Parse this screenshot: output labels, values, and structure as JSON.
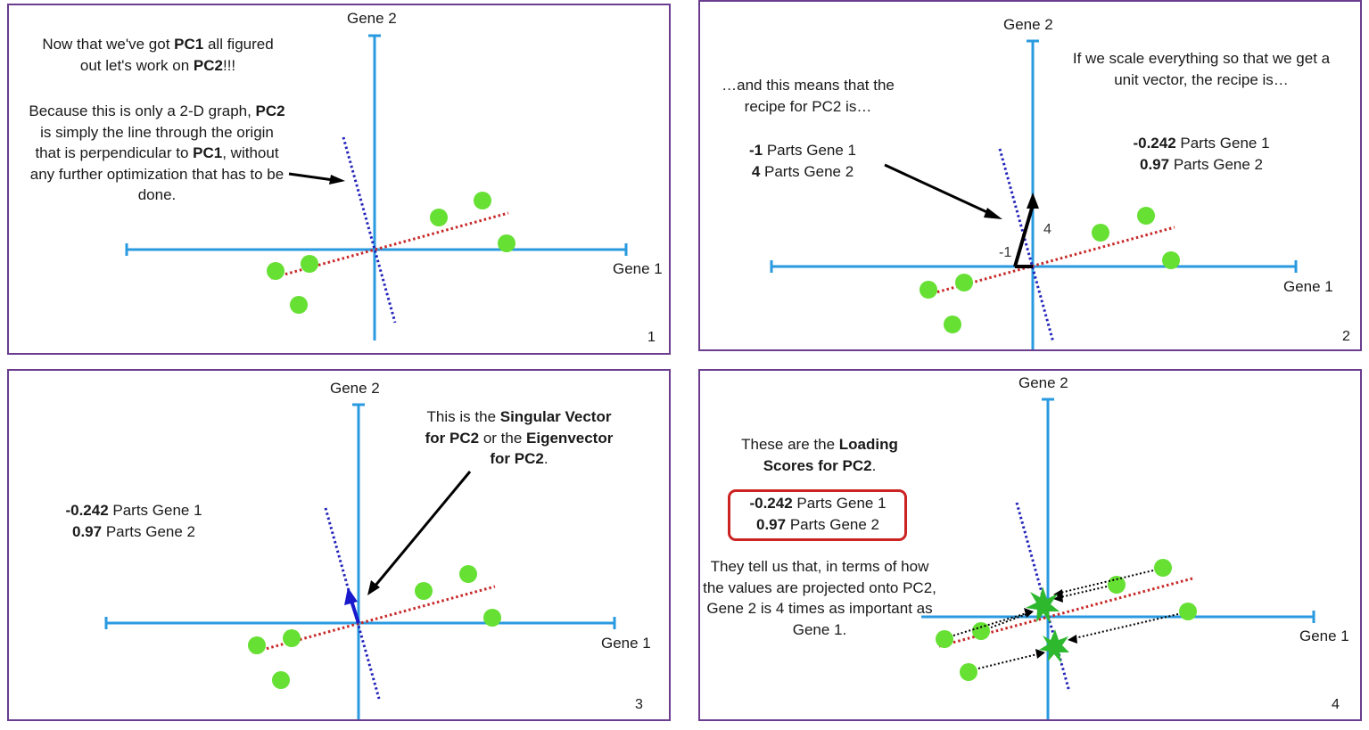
{
  "colors": {
    "frame": "#6a3d8f",
    "axis": "#2a9ae0",
    "pc1_line": "#c82828",
    "pc2_line": "#2222bb",
    "point": "#66e033",
    "projected_point": "#2eb82e",
    "arrow": "#000000",
    "singular_vector": "#1a1acc",
    "loading_box": "#cc2222"
  },
  "axis_labels": {
    "x": "Gene 1",
    "y": "Gene 2"
  },
  "panels": [
    {
      "number": "1",
      "text_main": {
        "pre": "Now that we've got ",
        "b1": "PC1",
        "mid": " all figured out let's work on ",
        "b2": "PC2",
        "post": "!!!"
      },
      "text_detail": {
        "pre": "Because this is only a 2-D graph, ",
        "b1": "PC2",
        "mid": " is simply the line through the origin that is perpendicular to ",
        "b2": "PC1",
        "post": ", without any further optimization that has to be done."
      }
    },
    {
      "number": "2",
      "text_recipe_intro": "…and this means that the recipe for PC2 is…",
      "recipe": [
        {
          "value": "-1",
          "label": " Parts Gene 1"
        },
        {
          "value": "4",
          "label": " Parts Gene 2"
        }
      ],
      "vector_labels": {
        "x": "-1",
        "y": "4"
      },
      "text_unit": {
        "pre": "If we scale everything so that we get a ",
        "b1": "unit vector",
        "post": ", the recipe is…"
      },
      "unit_recipe": [
        {
          "value": "-0.242",
          "label": " Parts Gene 1"
        },
        {
          "value": "0.97",
          "label": " Parts Gene 2"
        }
      ]
    },
    {
      "number": "3",
      "unit_recipe": [
        {
          "value": "-0.242",
          "label": " Parts Gene 1"
        },
        {
          "value": "0.97",
          "label": " Parts Gene 2"
        }
      ],
      "text_singular": {
        "pre": "This is the ",
        "b1": "Singular Vector for PC2",
        "mid": " or the ",
        "b2": "Eigenvector for PC2",
        "post": "."
      }
    },
    {
      "number": "4",
      "text_loading": {
        "pre": "These are the ",
        "b1": "Loading Scores for PC2",
        "post": "."
      },
      "loading_recipe": [
        {
          "value": "-0.242",
          "label": " Parts Gene 1"
        },
        {
          "value": "0.97",
          "label": " Parts Gene 2"
        }
      ],
      "text_explain": "They tell us that, in terms of how the values are projected onto PC2, Gene 2 is 4 times as important as Gene 1."
    }
  ]
}
